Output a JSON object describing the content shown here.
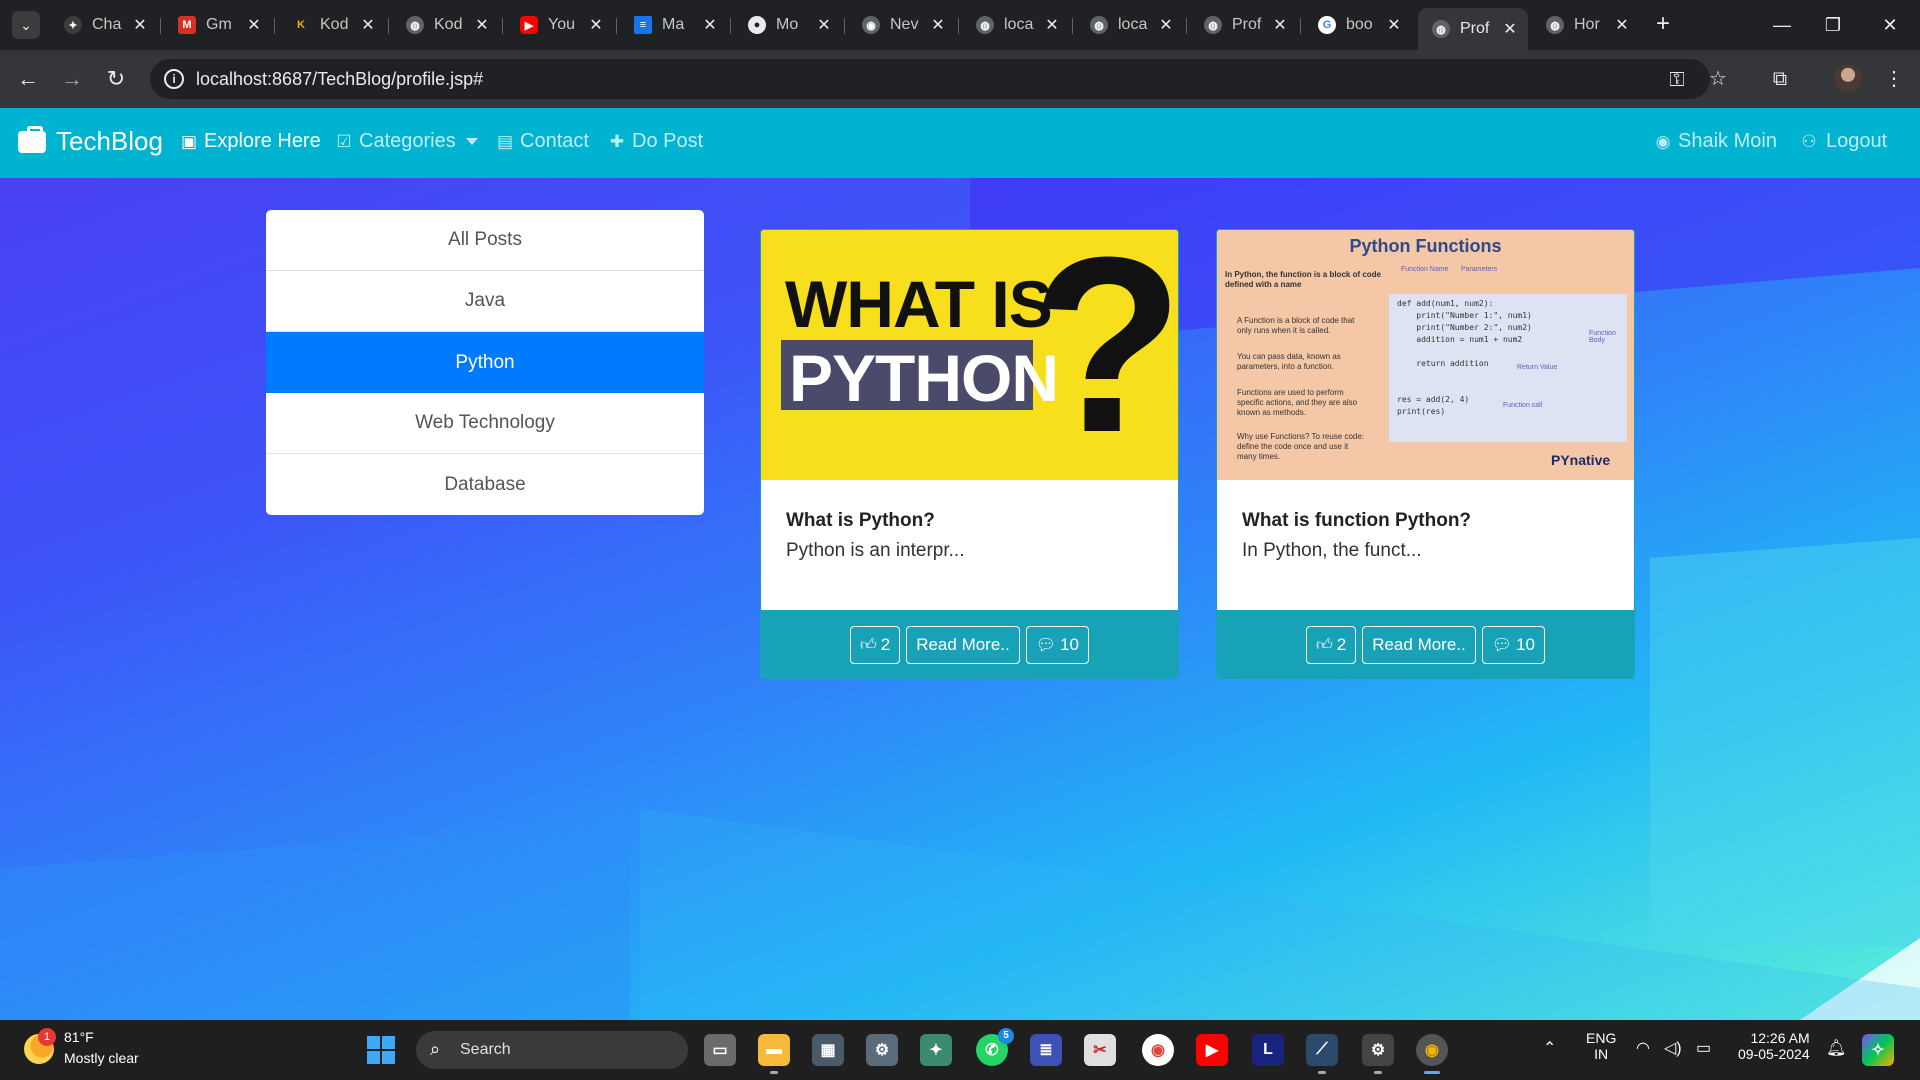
{
  "browser": {
    "tabs": [
      {
        "title": "ChatGPT",
        "icon": "chatgpt-icon",
        "color": "#3c3c3c"
      },
      {
        "title": "Gmail",
        "icon": "gmail-icon",
        "color": "#d93025"
      },
      {
        "title": "Kodnest",
        "icon": "kodnest-icon",
        "color": "#202124"
      },
      {
        "title": "Kodnest",
        "icon": "globe-icon",
        "color": "#5f6368"
      },
      {
        "title": "YouTube",
        "icon": "youtube-icon",
        "color": "#ff0000"
      },
      {
        "title": "Maven",
        "icon": "maven-icon",
        "color": "#1a73e8"
      },
      {
        "title": "Monday",
        "icon": "github-icon",
        "color": "#202124"
      },
      {
        "title": "New Tab",
        "icon": "chrome-icon",
        "color": "#5f6368"
      },
      {
        "title": "localhost",
        "icon": "globe-icon",
        "color": "#5f6368"
      },
      {
        "title": "localhost",
        "icon": "globe-icon",
        "color": "#5f6368"
      },
      {
        "title": "Profile",
        "icon": "globe-icon",
        "color": "#5f6368"
      },
      {
        "title": "boot",
        "icon": "google-icon",
        "color": "#ffffff"
      },
      {
        "title": "Profile",
        "icon": "globe-icon",
        "color": "#5f6368",
        "active": true
      },
      {
        "title": "Home",
        "icon": "globe-icon",
        "color": "#5f6368"
      }
    ],
    "tab_display": [
      "Cha",
      "Gm",
      "Kod",
      "Kod",
      "You",
      "Ma",
      "Mo",
      "Nev",
      "loca",
      "loca",
      "Prof",
      "boo",
      "Prof",
      "Hor"
    ],
    "url": "localhost:8687/TechBlog/profile.jsp#"
  },
  "navbar": {
    "brand": "TechBlog",
    "items": {
      "explore": "Explore Here",
      "categories": "Categories",
      "contact": "Contact",
      "do_post": "Do Post",
      "user": "Shaik Moin",
      "logout": "Logout"
    }
  },
  "categories": {
    "items": [
      "All Posts",
      "Java",
      "Python",
      "Web Technology",
      "Database"
    ],
    "active": "Python"
  },
  "posts": [
    {
      "title": "What is Python?",
      "excerpt": "Python is an interpr...",
      "likes": "2",
      "read_more": "Read More..",
      "comments": "10",
      "image_text": {
        "line1": "WHAT IS",
        "line2": "PYTHON",
        "mark": "?"
      }
    },
    {
      "title": "What is function Python?",
      "excerpt": "In Python, the funct...",
      "likes": "2",
      "read_more": "Read More..",
      "comments": "10",
      "image_text": {
        "title": "Python Functions",
        "intro": "In Python, the function is a block of code defined with a name",
        "bullet1": "A Function is a block of code that only runs when it is called.",
        "bullet2": "You can pass data, known as parameters, into a function.",
        "bullet3": "Functions are used to perform specific actions, and they are also known as methods.",
        "bullet4": "Why use Functions? To reuse code: define the code once and use it many times.",
        "fn_name_label": "Function Name",
        "params_label": "Parameters",
        "body_label": "Function Body",
        "return_label": "Return Value",
        "call_label": "Function call",
        "code": "def add(num1, num2):\n    print(\"Number 1:\", num1)\n    print(\"Number 2:\", num2)\n    addition = num1 + num2\n\n    return addition\n\n\nres = add(2, 4)\nprint(res)",
        "brand": "PYnative"
      }
    }
  ],
  "taskbar": {
    "weather_temp": "81°F",
    "weather_desc": "Mostly clear",
    "weather_badge": "1",
    "search": "Search",
    "whatsapp_badge": "5",
    "lang1": "ENG",
    "lang2": "IN",
    "time": "12:26 AM",
    "date": "09-05-2024"
  },
  "colors": {
    "navbar": "#00b3d1",
    "active_category": "#007bff",
    "card_footer": "#17a2b8"
  }
}
